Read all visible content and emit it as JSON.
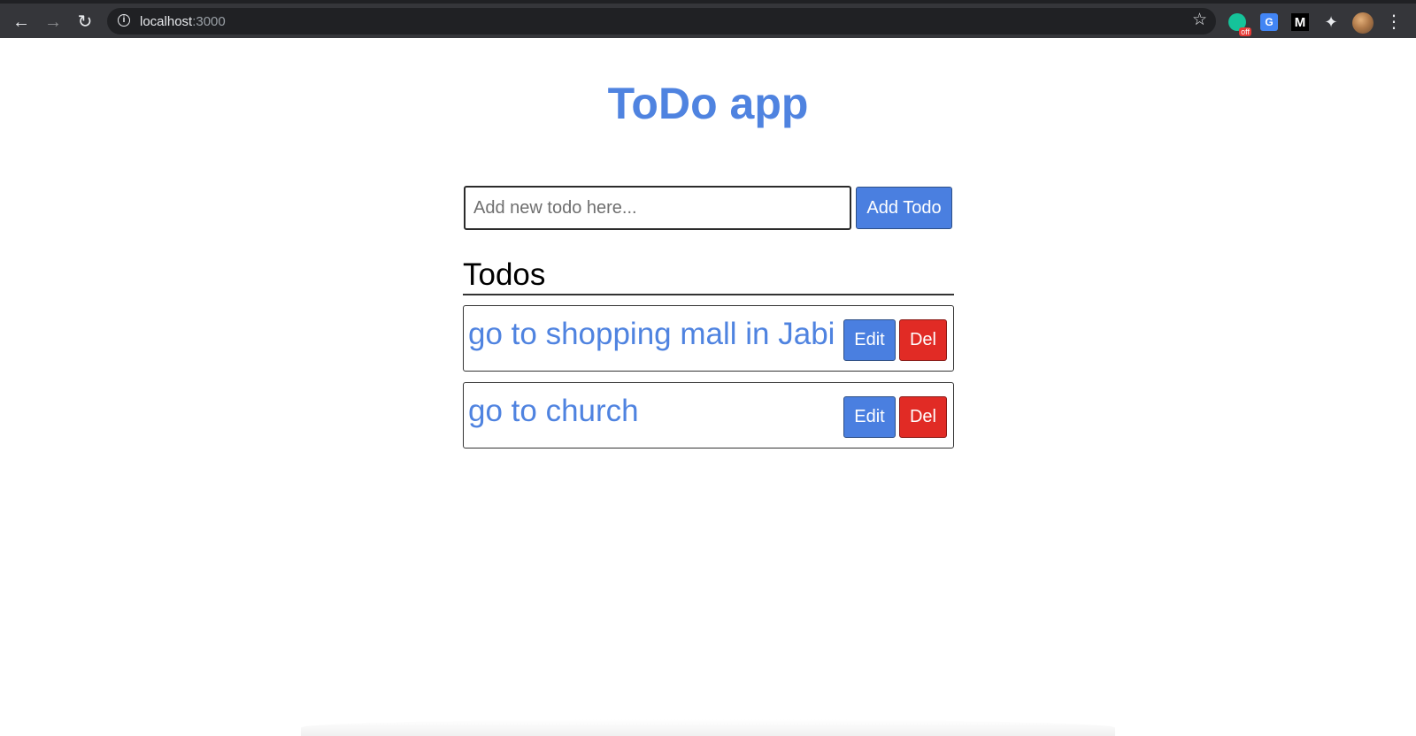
{
  "browser": {
    "url_host": "localhost",
    "url_port": ":3000",
    "extensions": {
      "grammarly_badge": "off",
      "translate_label": "G",
      "medium_label": "M"
    }
  },
  "app": {
    "title": "ToDo app",
    "input": {
      "value": "",
      "placeholder": "Add new todo here..."
    },
    "add_button_label": "Add Todo",
    "todos_heading": "Todos",
    "todos": [
      {
        "text": "go to shopping mall in Jabi",
        "edit_label": "Edit",
        "delete_label": "Del"
      },
      {
        "text": "go to church",
        "edit_label": "Edit",
        "delete_label": "Del"
      }
    ]
  },
  "colors": {
    "accent": "#4f83e0",
    "button_blue": "#4a7fe0",
    "button_red": "#e12b25",
    "browser_chrome": "#35363a"
  },
  "icons": [
    "back-arrow-icon",
    "forward-arrow-icon",
    "reload-icon",
    "info-icon",
    "bookmark-star-icon",
    "grammarly-icon",
    "google-translate-icon",
    "medium-icon",
    "extensions-puzzle-icon",
    "profile-avatar",
    "kebab-menu-icon"
  ]
}
